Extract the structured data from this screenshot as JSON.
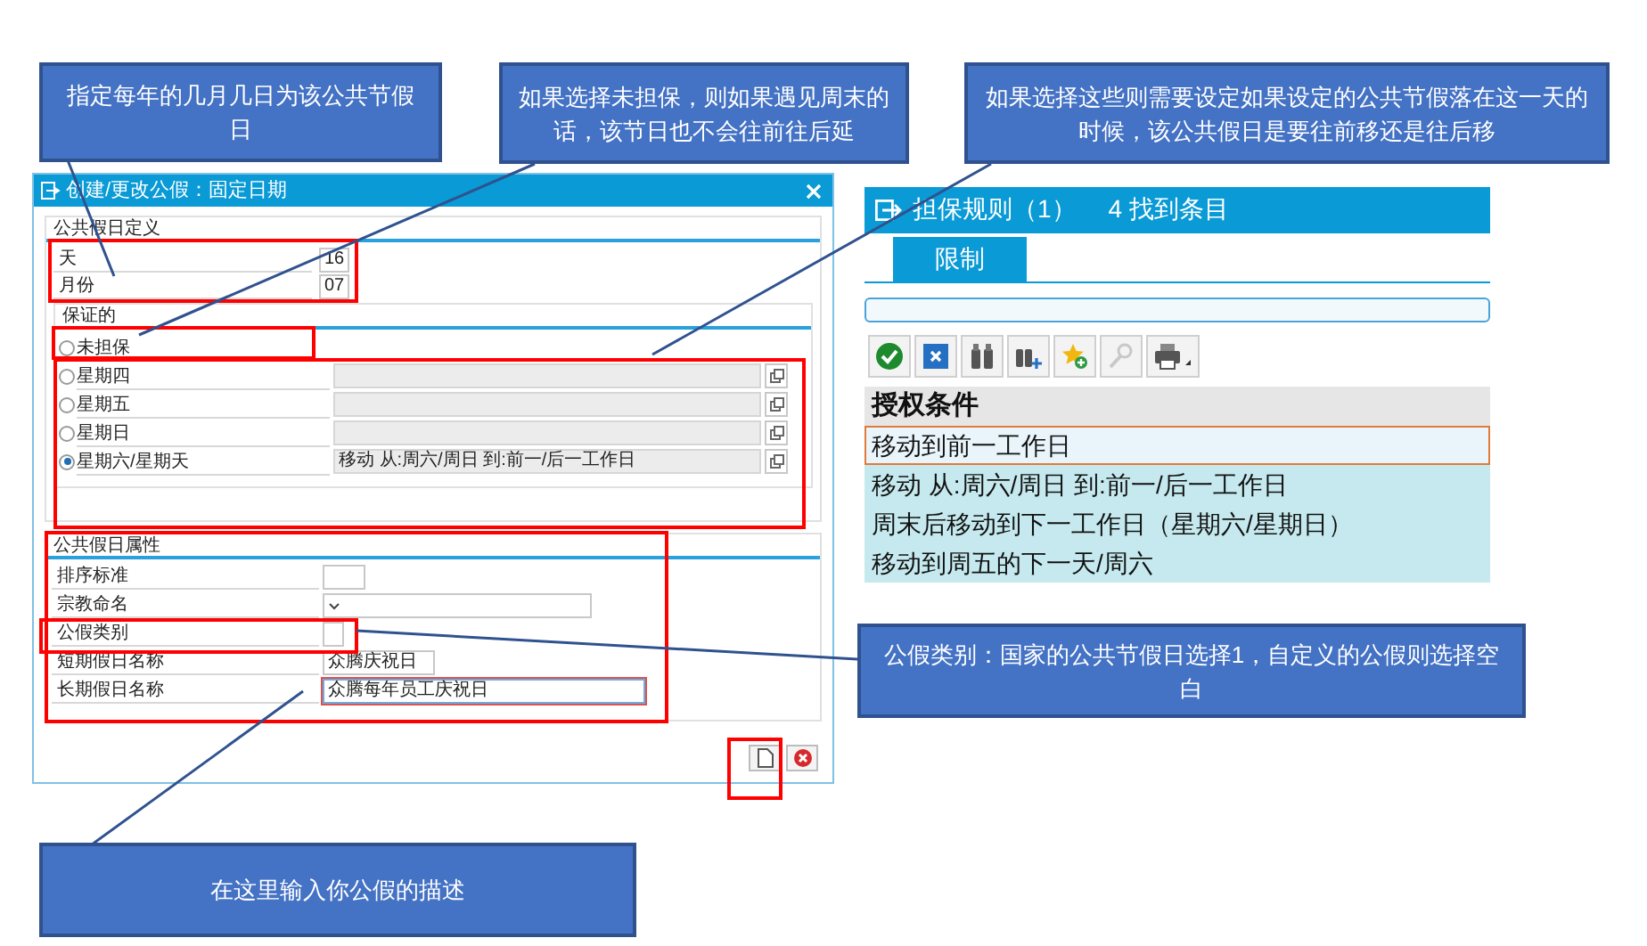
{
  "callouts": [
    {
      "text": "指定每年的几月几日为该公共节假日"
    },
    {
      "text": "如果选择未担保，则如果遇见周末的话，该节日也不会往前往后延"
    },
    {
      "text": "如果选择这些则需要设定如果设定的公共节假落在这一天的时候，该公共假日是要往前移还是往后移"
    },
    {
      "text": "公假类别：国家的公共节假日选择1，自定义的公假则选择空白"
    },
    {
      "text": "在这里输入你公假的描述"
    }
  ],
  "dialog": {
    "title": "创建/更改公假：固定日期",
    "definition": {
      "title": "公共假日定义",
      "fields": [
        {
          "label": "天",
          "value": "16"
        },
        {
          "label": "月份",
          "value": "07"
        }
      ]
    },
    "guarantee": {
      "title": "保证的",
      "options": [
        {
          "label": "未担保",
          "kind": "plain",
          "selected": false
        },
        {
          "label": "星期四",
          "kind": "rule",
          "selected": false
        },
        {
          "label": "星期五",
          "kind": "rule",
          "selected": false
        },
        {
          "label": "星期日",
          "kind": "rule",
          "selected": false
        },
        {
          "label": "星期六/星期天",
          "kind": "rule",
          "selected": true,
          "rule": "移动 从:周六/周日 到:前一/后一工作日"
        }
      ]
    },
    "attributes": {
      "title": "公共假日属性",
      "fields": [
        {
          "label": "排序标准",
          "kind": "short",
          "focused": false
        },
        {
          "label": "宗教命名",
          "kind": "dropdown",
          "focused": false
        },
        {
          "label": "公假类别",
          "kind": "tiny",
          "focused": false
        },
        {
          "label": "短期假日名称",
          "kind": "short",
          "value": "众腾庆祝日",
          "focused": false
        },
        {
          "label": "长期假日名称",
          "kind": "long",
          "value": "众腾每年员工庆祝日",
          "focused": true
        }
      ]
    }
  },
  "rules_panel": {
    "title": "担保规则（1）",
    "count": "4 找到条目",
    "tabs": [
      {
        "label": "限制",
        "selected": true
      }
    ],
    "column": "授权条件",
    "rows": [
      {
        "text": "移动到前一工作日",
        "selected": true
      },
      {
        "text": "移动 从:周六/周日 到:前一/后一工作日",
        "selected": false
      },
      {
        "text": "周末后移动到下一工作日（星期六/星期日）",
        "selected": false
      },
      {
        "text": "移动到周五的下一天/周六",
        "selected": false
      }
    ]
  }
}
